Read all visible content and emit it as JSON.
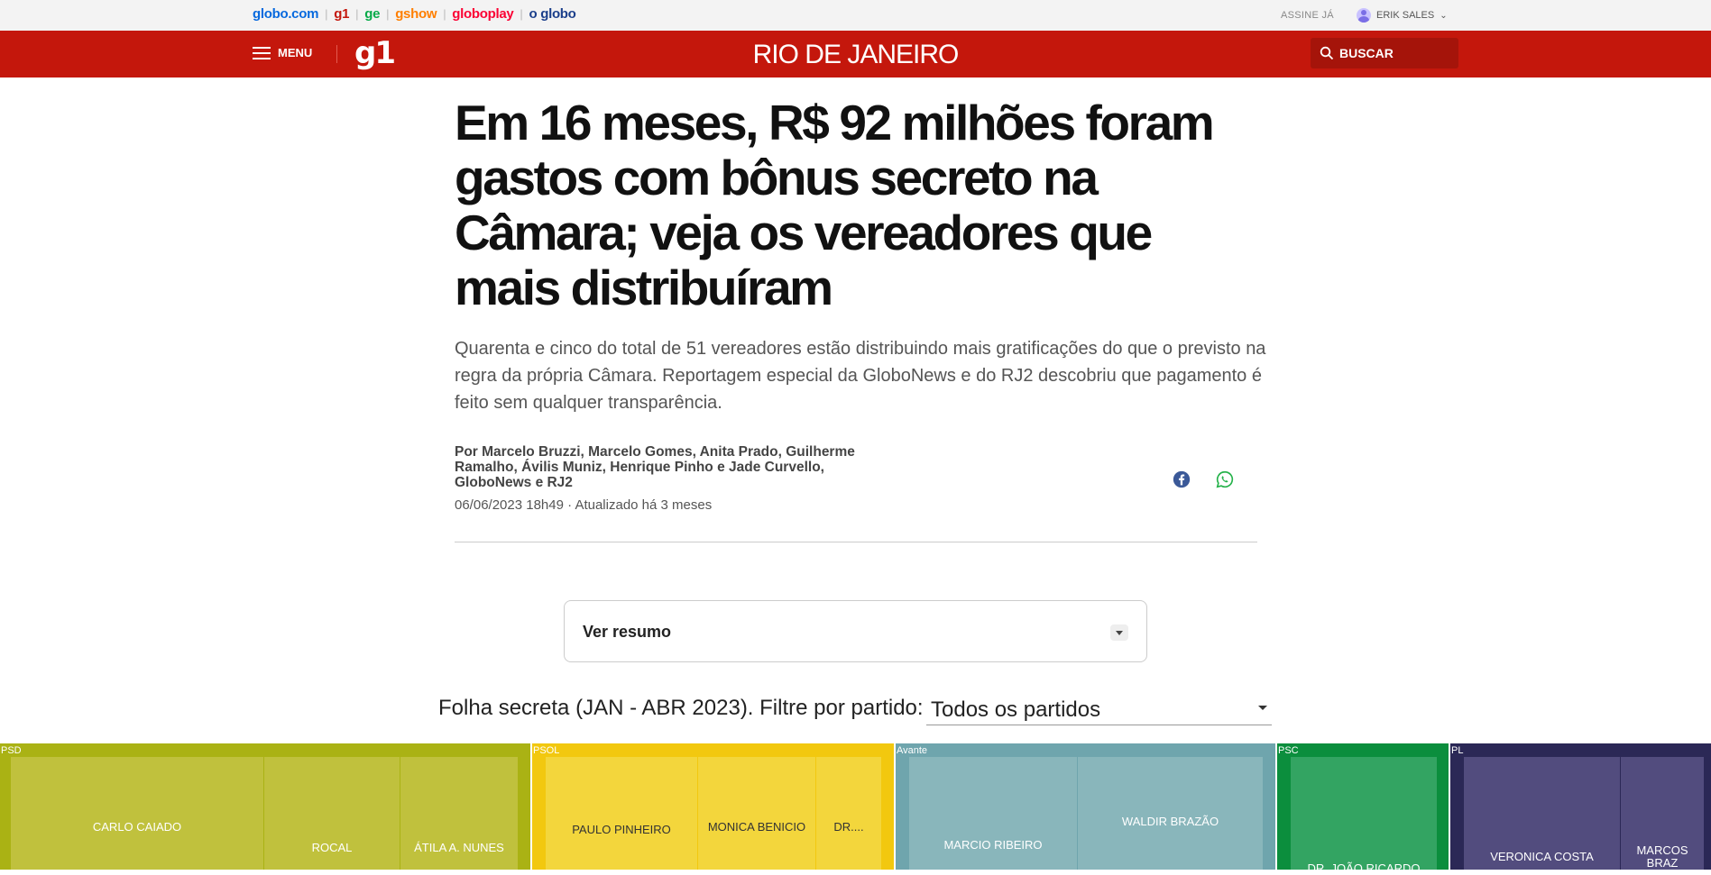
{
  "topbar": {
    "brands": [
      {
        "label": "globo.com",
        "color": "#0669de"
      },
      {
        "label": "g1",
        "color": "#c4170c"
      },
      {
        "label": "ge",
        "color": "#06aa48"
      },
      {
        "label": "gshow",
        "color": "#ff7f00"
      },
      {
        "label": "globoplay",
        "color": "#fb0234"
      },
      {
        "label": "o globo",
        "color": "#1b3f8b"
      }
    ],
    "assine": "ASSINE JÁ",
    "user_name": "ERIK SALES"
  },
  "header": {
    "menu_label": "MENU",
    "logo": "g1",
    "city": "RIO DE JANEIRO",
    "search_label": "BUSCAR",
    "brand_color": "#c4170c"
  },
  "article": {
    "headline": "Em 16 meses, R$ 92 milhões foram gastos com bônus secreto na Câmara; veja os vereadores que mais distribuíram",
    "subtitle": "Quarenta e cinco do total de 51 vereadores estão distribuindo mais gratificações do que o previsto na regra da própria Câmara. Reportagem especial da GloboNews e do RJ2 descobriu que pagamento é feito sem qualquer transparência.",
    "byline": "Por Marcelo Bruzzi, Marcelo Gomes, Anita Prado, Guilherme Ramalho, Ávilis Muniz, Henrique Pinho e Jade Curvello, GloboNews e RJ2",
    "date": "06/06/2023 18h49 · Atualizado há 3 meses",
    "share_icons": [
      "facebook-icon",
      "whatsapp-icon"
    ]
  },
  "resumo": {
    "label": "Ver resumo"
  },
  "filter": {
    "label": "Folha secreta (JAN - ABR 2023). Filtre por partido:",
    "selected": "Todos os partidos"
  },
  "treemap": {
    "parties": [
      {
        "name": "PSD",
        "color": "#aab214",
        "cells": [
          "CARLO CAIADO",
          "ROCAL",
          "ÁTILA A. NUNES"
        ]
      },
      {
        "name": "PSOL",
        "color": "#f2c80f",
        "cells": [
          "PAULO PINHEIRO",
          "MONICA BENICIO",
          "DR...."
        ]
      },
      {
        "name": "Avante",
        "color": "#6fa5ad",
        "cells": [
          "MARCIO RIBEIRO",
          "WALDIR BRAZÃO"
        ]
      },
      {
        "name": "PSC",
        "color": "#0b8e3d",
        "cells": [
          "DR. JOÃO RICARDO"
        ]
      },
      {
        "name": "PL",
        "color": "#2b2856",
        "cells": [
          "VERONICA COSTA",
          "MARCOS BRAZ"
        ]
      }
    ]
  }
}
